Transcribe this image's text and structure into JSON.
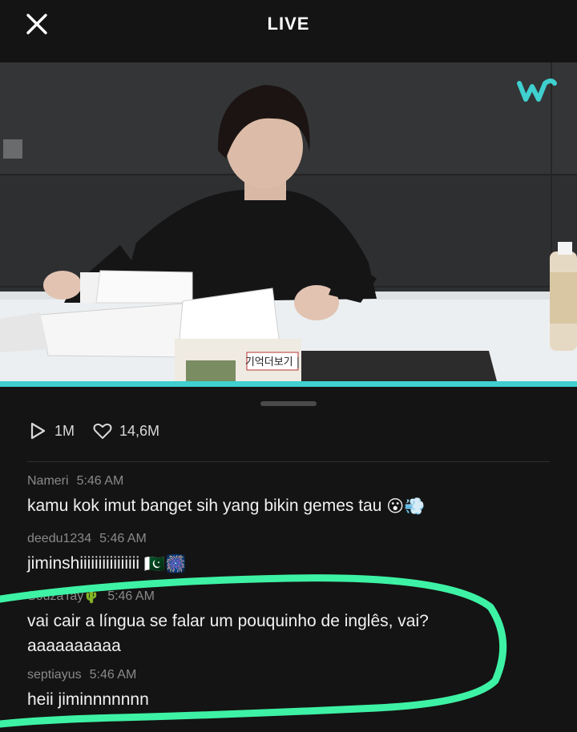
{
  "header": {
    "title": "LIVE",
    "close_icon": "close-icon"
  },
  "video": {
    "logo_icon": "weverse-logo-icon",
    "accent_color": "#3fd0cf",
    "box_text": "기억더보기 |"
  },
  "stats": {
    "plays": "1M",
    "likes": "14,6M",
    "play_icon": "play-icon",
    "heart_icon": "heart-icon"
  },
  "comments": [
    {
      "user": "Nameri",
      "time": "5:46 AM",
      "text": "kamu kok imut banget sih yang bikin gemes tau",
      "emojis": [
        "😮",
        "💨"
      ]
    },
    {
      "user": "deedu1234",
      "time": "5:46 AM",
      "text": "jiminshiiiiiiiiiiiiiiii",
      "emojis": [
        "🇵🇰",
        "🎆"
      ]
    },
    {
      "user": "SouzaTay",
      "user_emoji": "🌵",
      "time": "5:46 AM",
      "text_line1": "vai cair a língua se falar um pouquinho de inglês, vai?",
      "text_line2": "aaaaaaaaaa"
    },
    {
      "user": "septiayus",
      "time": "5:46 AM",
      "text": "heii jiminnnnnnn"
    }
  ],
  "highlight_color": "#3df2a4"
}
